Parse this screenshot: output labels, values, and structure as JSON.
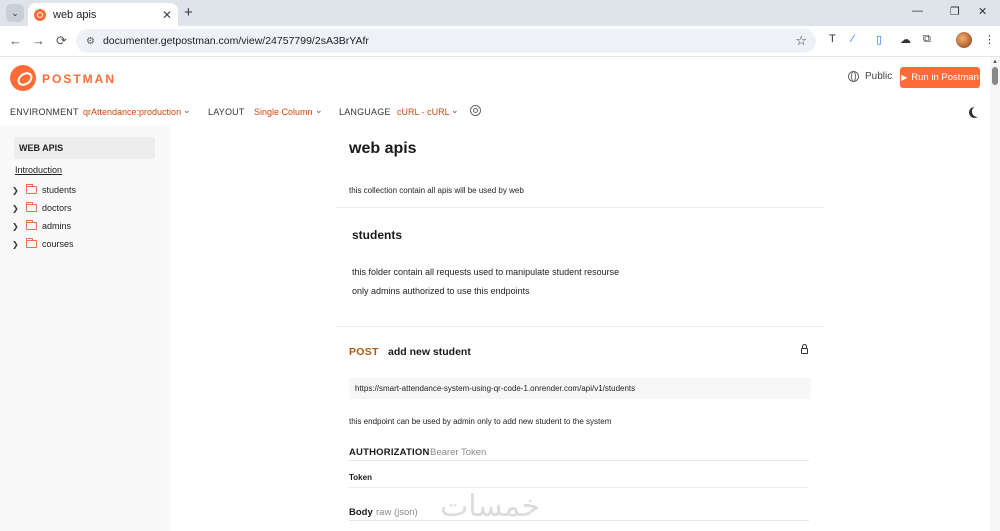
{
  "browser": {
    "tab_title": "web apis",
    "tab_close": "✕",
    "new_tab": "+",
    "url": "documenter.getpostman.com/view/24757799/2sA3BrYAfr",
    "back": "←",
    "forward": "→",
    "reload": "⟳",
    "bookmark": "☆",
    "window_minimize": "—",
    "window_restore": "❐",
    "window_close": "✕",
    "menu": "⋮"
  },
  "postman": {
    "logo_text": "POSTMAN",
    "visibility": "Public",
    "run_button": "Run in Postman",
    "settings": {
      "environment_label": "ENVIRONMENT",
      "environment_value": "qrAttendance:production",
      "layout_label": "LAYOUT",
      "layout_value": "Single Column",
      "language_label": "LANGUAGE",
      "language_value": "cURL - cURL"
    }
  },
  "sidebar": {
    "heading": "WEB APIS",
    "intro": "Introduction",
    "folders": [
      {
        "label": "students"
      },
      {
        "label": "doctors"
      },
      {
        "label": "admins"
      },
      {
        "label": "courses"
      }
    ]
  },
  "collection": {
    "title": "web apis",
    "description": "this collection contain all apis will be used by web"
  },
  "folder": {
    "title": "students",
    "description_lines": [
      "this folder contain all requests used to manipulate student resourse",
      "only admins authorized to use this endpoints"
    ]
  },
  "request": {
    "method": "POST",
    "name": "add new student",
    "url": "https://smart-attendance-system-using-qr-code-1.onrender.com/api/v1/students",
    "description": "this endpoint can be used by admin only to add new student to the system",
    "auth_label": "AUTHORIZATION",
    "auth_type": "Bearer Token",
    "token_label": "Token",
    "body_label": "Body",
    "body_type": "raw (json)"
  },
  "watermark": "خمسات",
  "colors": {
    "brand": "#ff6c37",
    "accent_text": "#d4460a",
    "method_post": "#b4560b"
  }
}
